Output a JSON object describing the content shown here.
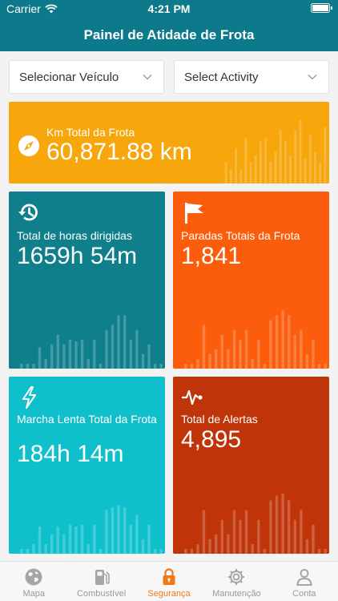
{
  "status": {
    "carrier": "Carrier",
    "time": "4:21 PM"
  },
  "header": {
    "title": "Painel de Atidade de Frota"
  },
  "filters": {
    "vehicle": "Selecionar Veículo",
    "activity": "Select Activity"
  },
  "cards": {
    "km": {
      "label": "Km Total da Frota",
      "value": "60,871.88 km",
      "icon": "compass-icon",
      "color": "#f7a60b"
    },
    "hours": {
      "label": "Total de horas dirigidas",
      "value": "1659h 54m",
      "icon": "history-icon",
      "color": "#0f7f8c"
    },
    "stops": {
      "label": "Paradas Totais da Frota",
      "value": "1,841",
      "icon": "flag-icon",
      "color": "#fb5d0c"
    },
    "idle": {
      "label": "Marcha Lenta Total da Frota",
      "value": "184h 14m",
      "icon": "bolt-icon",
      "color": "#0fc0cc"
    },
    "alerts": {
      "label": "Total de Alertas",
      "value": "4,895",
      "icon": "pulse-icon",
      "color": "#bf3408"
    }
  },
  "tabs": [
    {
      "label": "Mapa",
      "icon": "globe-icon",
      "active": false
    },
    {
      "label": "Combustível",
      "icon": "fuel-icon",
      "active": false
    },
    {
      "label": "Segurança",
      "icon": "lock-icon",
      "active": true
    },
    {
      "label": "Manutenção",
      "icon": "gear-icon",
      "active": false
    },
    {
      "label": "Conta",
      "icon": "user-icon",
      "active": false
    }
  ],
  "sparklines": {
    "km": [
      0.3,
      0.2,
      0.5,
      0.2,
      0.65,
      0.3,
      0.4,
      0.6,
      0.65,
      0.3,
      0.45,
      0.75,
      0.6,
      0.4,
      0.75,
      0.9,
      0.35,
      0.7,
      0.45,
      0.3,
      0.8
    ],
    "hours": [
      0.05,
      0.05,
      0.05,
      0.22,
      0.1,
      0.25,
      0.35,
      0.25,
      0.3,
      0.28,
      0.3,
      0.1,
      0.3,
      0.05,
      0.4,
      0.45,
      0.55,
      0.55,
      0.3,
      0.4,
      0.15,
      0.25,
      0.05,
      0.05
    ],
    "stops": [
      0.05,
      0.05,
      0.1,
      0.45,
      0.15,
      0.2,
      0.35,
      0.2,
      0.4,
      0.3,
      0.4,
      0.1,
      0.3,
      0.05,
      0.5,
      0.55,
      0.6,
      0.55,
      0.35,
      0.4,
      0.15,
      0.3,
      0.05,
      0.05
    ],
    "idle": [
      0.05,
      0.05,
      0.1,
      0.28,
      0.1,
      0.2,
      0.28,
      0.2,
      0.3,
      0.28,
      0.3,
      0.1,
      0.3,
      0.05,
      0.45,
      0.48,
      0.5,
      0.48,
      0.3,
      0.4,
      0.15,
      0.3,
      0.05,
      0.05
    ],
    "alerts": [
      0.05,
      0.05,
      0.1,
      0.45,
      0.15,
      0.2,
      0.35,
      0.2,
      0.45,
      0.35,
      0.45,
      0.1,
      0.35,
      0.05,
      0.55,
      0.6,
      0.62,
      0.55,
      0.35,
      0.45,
      0.15,
      0.3,
      0.05,
      0.05
    ]
  }
}
